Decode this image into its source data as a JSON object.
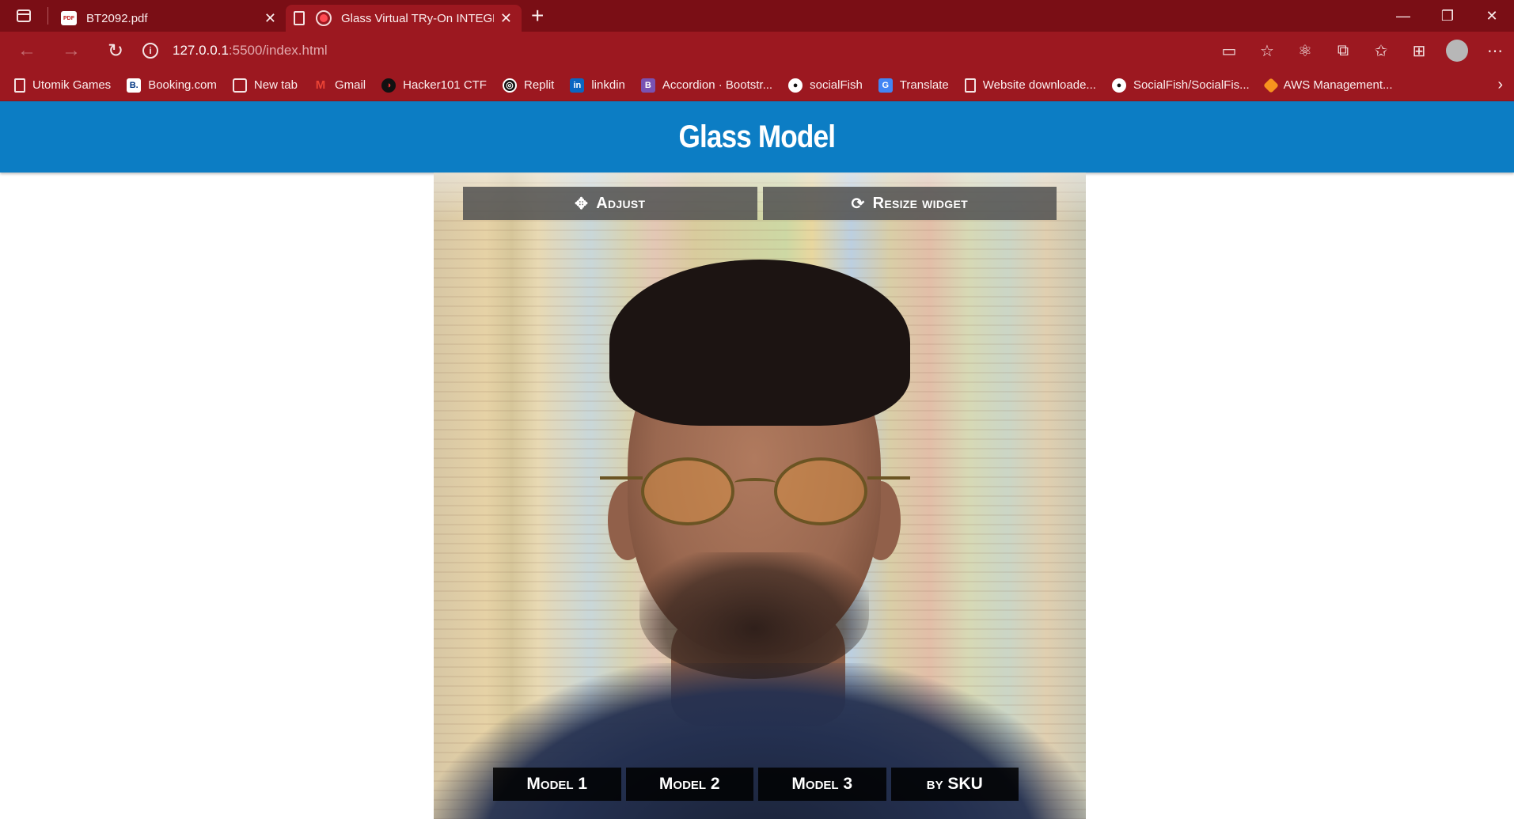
{
  "browser": {
    "tabs": [
      {
        "title": "BT2092.pdf",
        "icon": "pdf-icon",
        "active": false
      },
      {
        "title": "Glass Virtual TRy-On INTEGRATION",
        "icon": "page-icon",
        "active": true
      }
    ],
    "new_tab_label": "+",
    "url_host": "127.0.0.1",
    "url_path": ":5500/index.html",
    "bookmarks": [
      {
        "label": "Utomik Games",
        "icon": "page-icon"
      },
      {
        "label": "Booking.com",
        "icon": "booking-icon"
      },
      {
        "label": "New tab",
        "icon": "new-tab-icon"
      },
      {
        "label": "Gmail",
        "icon": "gmail-icon"
      },
      {
        "label": "Hacker101 CTF",
        "icon": "hacker101-icon"
      },
      {
        "label": "Replit",
        "icon": "replit-icon"
      },
      {
        "label": "linkdin",
        "icon": "linkedin-icon"
      },
      {
        "label": "Accordion · Bootstr...",
        "icon": "bootstrap-icon"
      },
      {
        "label": "socialFish",
        "icon": "github-icon"
      },
      {
        "label": "Translate",
        "icon": "translate-icon"
      },
      {
        "label": "Website downloade...",
        "icon": "page-icon"
      },
      {
        "label": "SocialFish/SocialFis...",
        "icon": "github-icon"
      },
      {
        "label": "AWS Management...",
        "icon": "aws-icon"
      }
    ]
  },
  "app": {
    "title": "Glass Model",
    "controls": {
      "adjust_label": "Adjust",
      "resize_label": "Resize widget"
    },
    "models": [
      "Model 1",
      "Model 2",
      "Model 3",
      "by SKU"
    ]
  },
  "colors": {
    "header_bg": "#0c7dc4",
    "browser_frame": "#9c1820",
    "tabstrip": "#7a0e15"
  }
}
